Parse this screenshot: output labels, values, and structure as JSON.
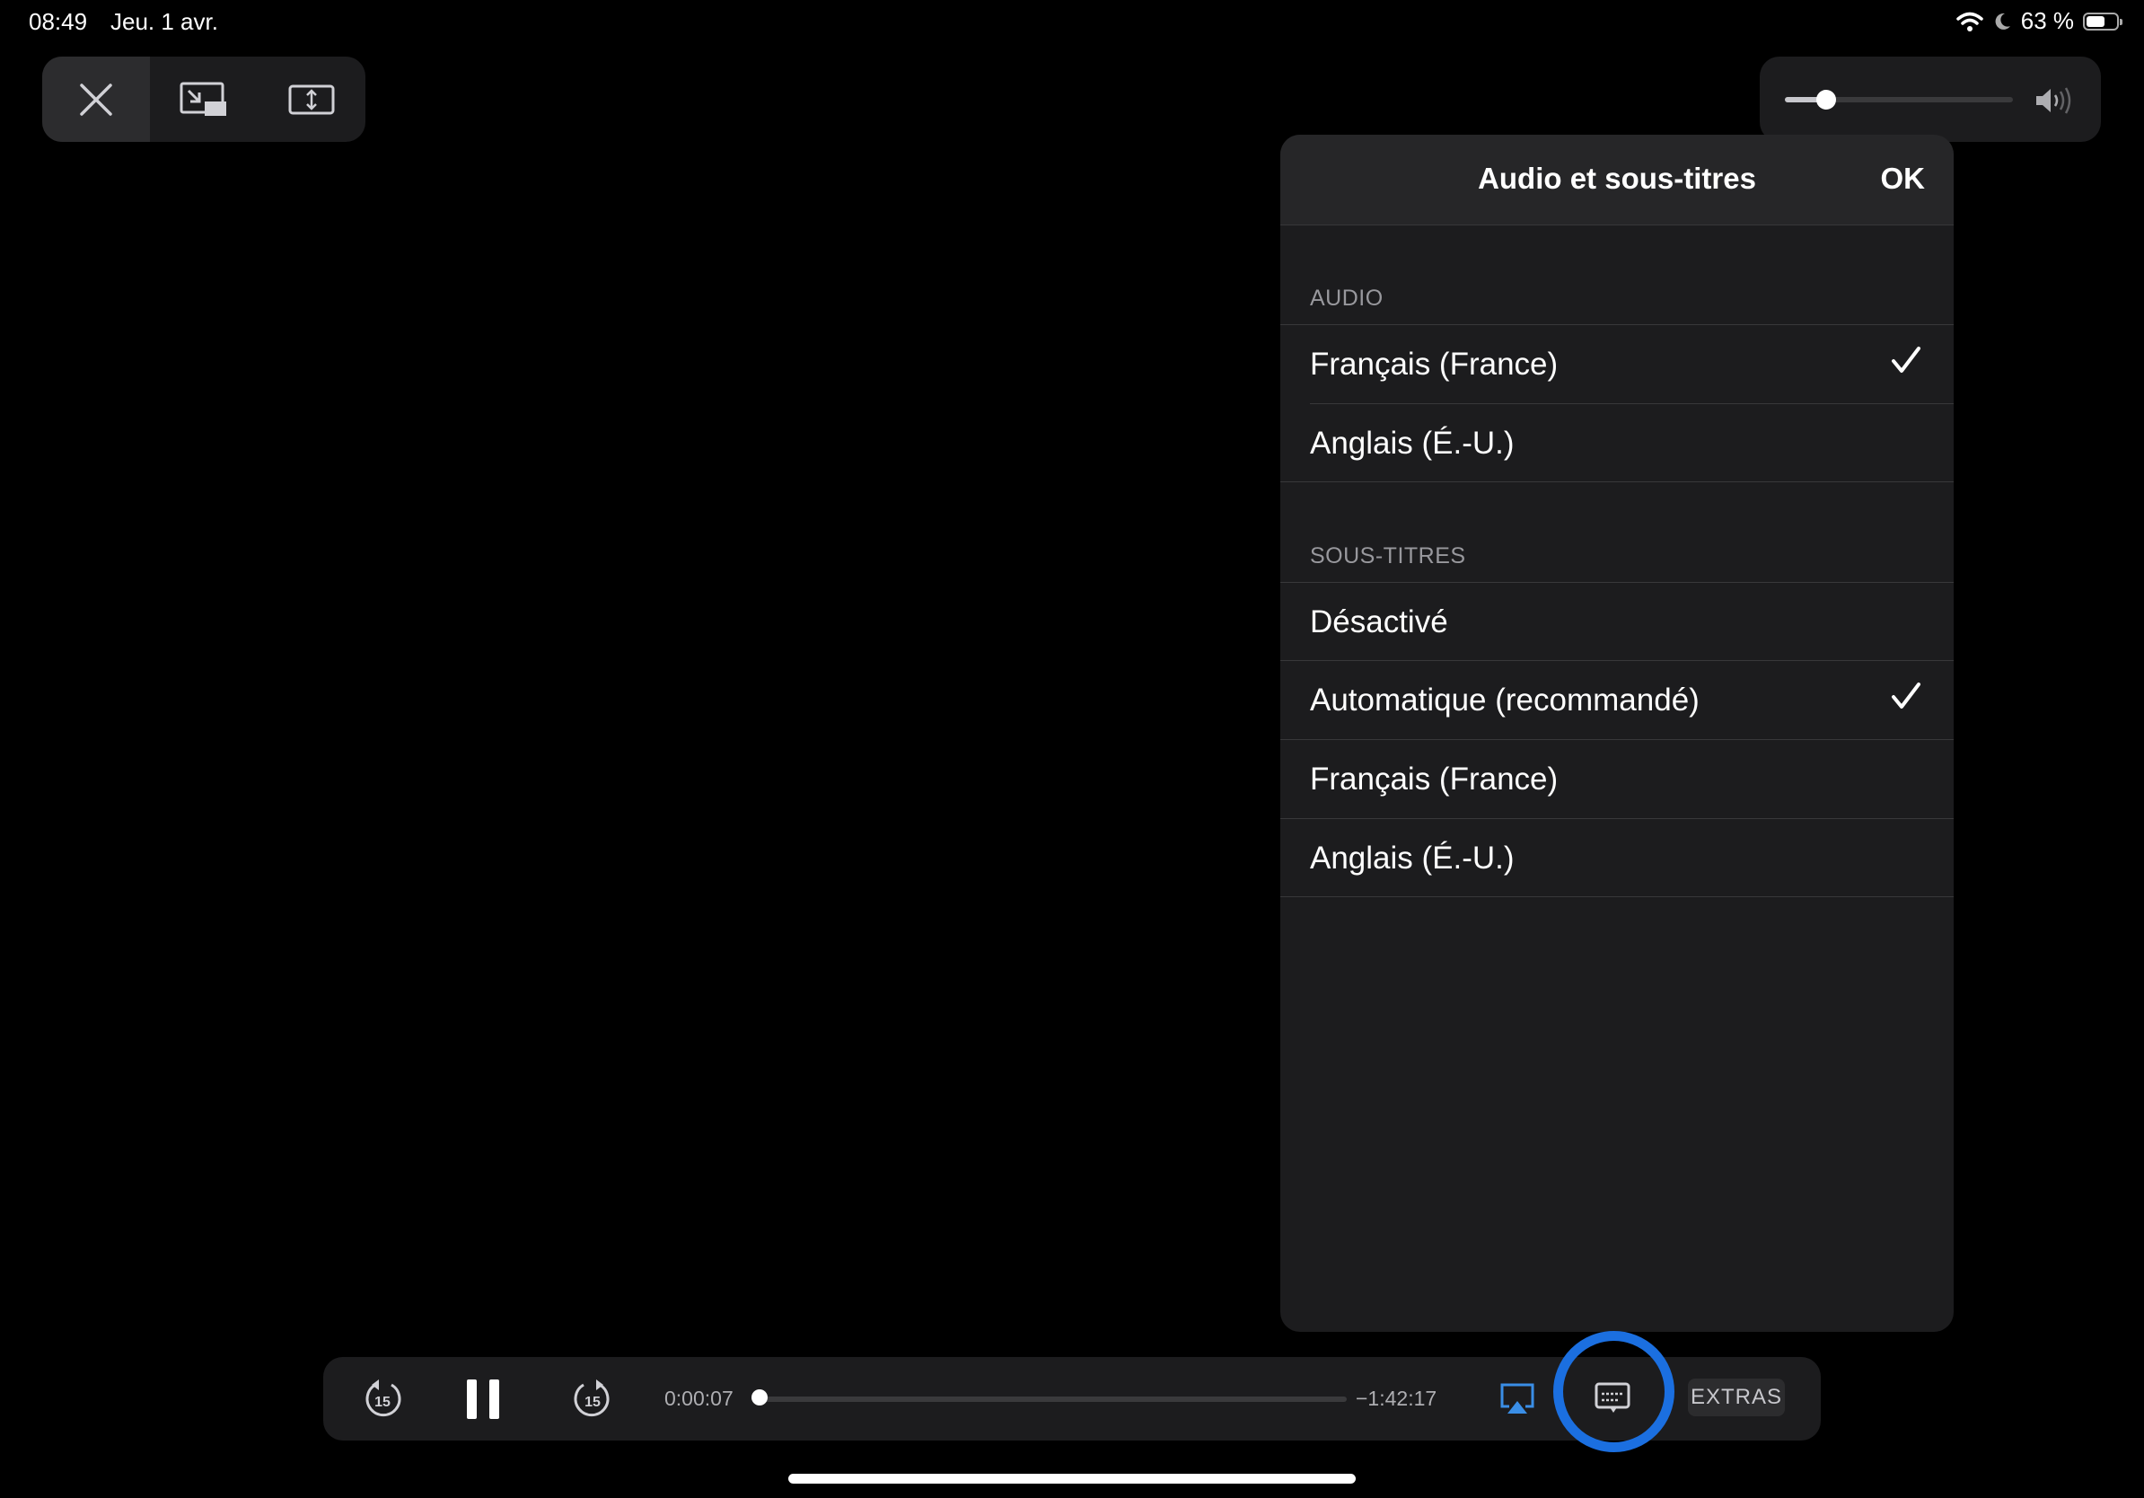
{
  "status_bar": {
    "time": "08:49",
    "date": "Jeu. 1 avr.",
    "battery_text": "63 %",
    "battery_level": 0.63
  },
  "top_controls": {
    "close_icon": "close-icon",
    "pip_icon": "picture-in-picture-icon",
    "aspect_icon": "aspect-ratio-icon"
  },
  "volume": {
    "level": 0.18,
    "icon": "speaker-icon"
  },
  "panel": {
    "title": "Audio et sous-titres",
    "ok_label": "OK",
    "audio_header": "AUDIO",
    "audio_options": [
      {
        "label": "Français (France)",
        "selected": true
      },
      {
        "label": "Anglais (É.-U.)",
        "selected": false
      }
    ],
    "subtitles_header": "SOUS-TITRES",
    "subtitle_options": [
      {
        "label": "Désactivé",
        "selected": false
      },
      {
        "label": "Automatique (recommandé)",
        "selected": true
      },
      {
        "label": "Français (France)",
        "selected": false
      },
      {
        "label": "Anglais (É.-U.)",
        "selected": false
      }
    ]
  },
  "player": {
    "skip_back_label": "15",
    "skip_forward_label": "15",
    "elapsed": "0:00:07",
    "remaining": "−1:42:17",
    "progress": 0.001,
    "extras_label": "EXTRAS",
    "accent_color": "#1b6fe0",
    "airplay_color": "#3a8ee6"
  }
}
